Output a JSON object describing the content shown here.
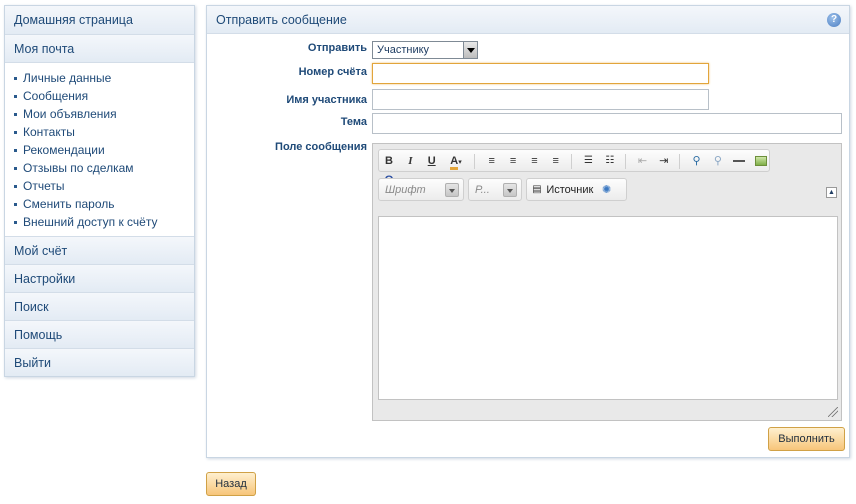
{
  "sidebar": {
    "home": "Домашняя страница",
    "mail": "Моя почта",
    "mail_items": [
      "Личные данные",
      "Сообщения",
      "Мои объявления",
      "Контакты",
      "Рекомендации",
      "Отзывы по сделкам",
      "Отчеты",
      "Сменить пароль",
      "Внешний доступ к счёту"
    ],
    "account": "Мой счёт",
    "settings": "Настройки",
    "search": "Поиск",
    "help": "Помощь",
    "logout": "Выйти"
  },
  "panel": {
    "title": "Отправить сообщение",
    "help_glyph": "?"
  },
  "form": {
    "send_label": "Отправить",
    "send_value": "Участнику",
    "account_label": "Номер счёта",
    "account_value": "",
    "member_label": "Имя участника",
    "member_value": "",
    "subject_label": "Тема",
    "subject_value": "",
    "message_label": "Поле сообщения"
  },
  "editor": {
    "font_placeholder": "Шрифт",
    "size_placeholder": "Р...",
    "source_label": "Источник",
    "toolbar_icons": [
      "bold-icon",
      "italic-icon",
      "underline-icon",
      "text-color-icon",
      "align-left-icon",
      "align-center-icon",
      "align-right-icon",
      "align-justify-icon",
      "numbered-list-icon",
      "bullet-list-icon",
      "outdent-icon",
      "indent-icon",
      "find-icon",
      "replace-icon",
      "horizontal-rule-icon",
      "image-icon",
      "special-char-icon"
    ]
  },
  "buttons": {
    "submit": "Выполнить",
    "back": "Назад"
  },
  "colors": {
    "accent": "#1f4a78",
    "button_bg": "#f7c57a",
    "focus": "#e2a53b"
  }
}
